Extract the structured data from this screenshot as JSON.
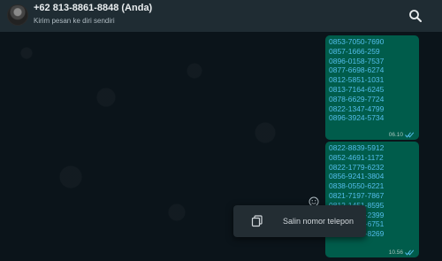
{
  "header": {
    "title": "+62 813-8861-8848 (Anda)",
    "subtitle": "Kirim pesan ke diri sendiri",
    "search_icon": "search-icon"
  },
  "messages": [
    {
      "numbers": [
        "0853-7050-7690",
        "0857-1666-259",
        "0896-0158-7537",
        "0877-6698-6274",
        "0812-5851-1031",
        "0813-7164-6245",
        "0878-6629-7724",
        "0822-1347-4799",
        "0896-3924-5734"
      ],
      "time": "06.10",
      "status": "read"
    },
    {
      "numbers": [
        "0822-8839-5912",
        "0852-4691-1172",
        "0822-1779-6232",
        "0856-9241-3804",
        "0838-0550-6221",
        "0821-7197-7867",
        "0812-1451-8595",
        "0895-7741-2399",
        "0852-4454-6751",
        "0857-1867-8269"
      ],
      "time": "10.56",
      "status": "read"
    }
  ],
  "emoji_button_icon": "emoji-icon",
  "toast": {
    "label": "Salin nomor telepon",
    "icon": "copy-icon"
  },
  "colors": {
    "background": "#0b141a",
    "header": "#1f2c33",
    "bubble": "#005c4b",
    "link": "#53bdeb",
    "read_ticks": "#53bdeb"
  }
}
